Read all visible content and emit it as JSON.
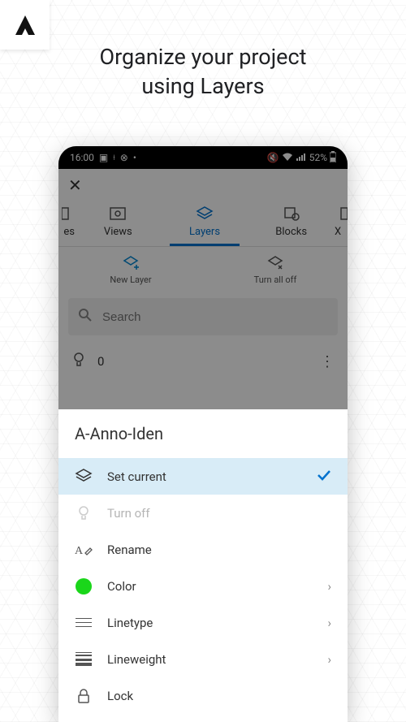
{
  "headline": "Organize your project\nusing Layers",
  "status": {
    "time": "16:00",
    "battery": "52%"
  },
  "tabs": {
    "edge_left": "es",
    "views": "Views",
    "layers": "Layers",
    "blocks": "Blocks",
    "edge_right": "X"
  },
  "actions": {
    "new_layer": "New Layer",
    "turn_all_off": "Turn all off"
  },
  "search": {
    "placeholder": "Search"
  },
  "layer_list": {
    "first_name": "0"
  },
  "sheet": {
    "title": "A-Anno-Iden",
    "items": {
      "set_current": "Set current",
      "turn_off": "Turn off",
      "rename": "Rename",
      "color": "Color",
      "linetype": "Linetype",
      "lineweight": "Lineweight",
      "lock": "Lock"
    },
    "color_value": "#1ad61a"
  }
}
